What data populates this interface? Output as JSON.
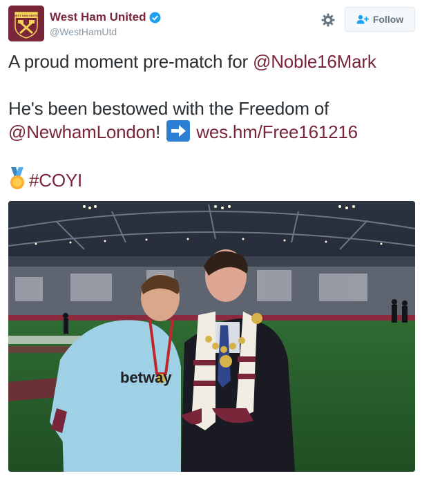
{
  "account": {
    "display_name": "West Ham United",
    "screen_name": "@WestHamUtd",
    "avatar_text": "WEST HAM UNITED",
    "verified": true,
    "brand_color": "#7a263a"
  },
  "actions": {
    "follow_label": "Follow",
    "settings_icon": "gear-icon",
    "follow_icon": "add-user-icon"
  },
  "tweet": {
    "line1_text": "A proud moment pre-match for ",
    "line1_mention": "@Noble16Mark",
    "line2_text": "He's been bestowed with the Freedom of",
    "line3_mention": "@NewhamLondon",
    "line3_text": "!",
    "line3_emoji": "right-arrow-icon",
    "line3_link": "wes.hm/Free161216",
    "line4_emoji": "medal-icon",
    "line4_hashtag": "#COYI"
  },
  "media": {
    "jersey_sponsor": "betway",
    "icon": "photo"
  }
}
